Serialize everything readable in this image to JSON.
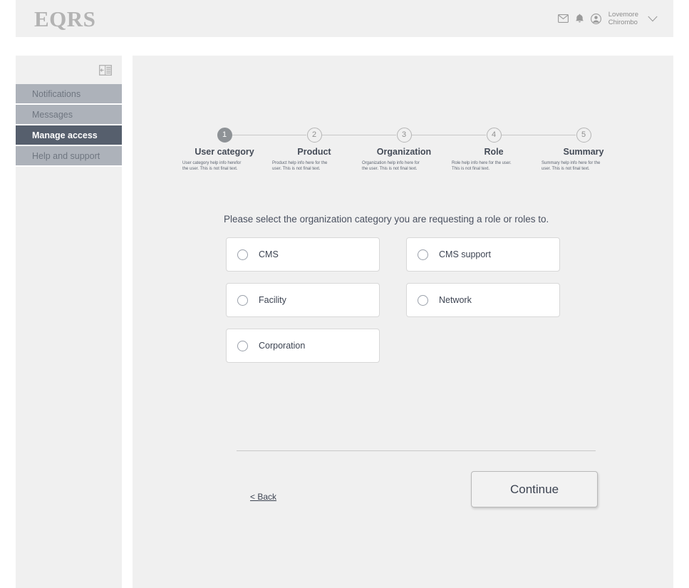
{
  "header": {
    "brand": "EQRS",
    "mail_icon": "envelope-icon",
    "bell_icon": "bell-icon",
    "avatar_icon": "avatar-icon",
    "user_first_name": "Lovemore",
    "user_last_name": "Chirombo",
    "chevron_icon": "chevron-down-icon"
  },
  "sidebar": {
    "collapse_icon": "collapse-sidebar-icon",
    "items": [
      {
        "label": "Notifications",
        "active": false
      },
      {
        "label": "Messages",
        "active": false
      },
      {
        "label": "Manage access",
        "active": true
      },
      {
        "label": "Help and support",
        "active": false
      }
    ]
  },
  "stepper": {
    "steps": [
      {
        "number": "1",
        "title": "User category",
        "help": "User category help info herefor the user. This is not final text.",
        "state": "done"
      },
      {
        "number": "2",
        "title": "Product",
        "help": "Product help info here for the user. This is not final text.",
        "state": "todo"
      },
      {
        "number": "3",
        "title": "Organization",
        "help": "Organization help info here for the user. This is not final text.",
        "state": "todo"
      },
      {
        "number": "4",
        "title": "Role",
        "help": "Role help info here for the user. This is not final text.",
        "state": "todo"
      },
      {
        "number": "5",
        "title": "Summary",
        "help": "Summary help info here for the user. This is not final text.",
        "state": "todo"
      }
    ]
  },
  "main": {
    "question": "Please select the organization category you are requesting a role or roles to.",
    "options": [
      {
        "label": "CMS",
        "selected": false
      },
      {
        "label": "CMS support",
        "selected": false
      },
      {
        "label": "Facility",
        "selected": false
      },
      {
        "label": "Network",
        "selected": false
      },
      {
        "label": "Corporation",
        "selected": false
      }
    ],
    "back_label": "< Back",
    "continue_label": "Continue"
  },
  "colors": {
    "page_bg": "#ffffff",
    "panel_bg": "#f0f0f0",
    "nav_item_bg": "#adb2ba",
    "nav_item_active_bg": "#565f6d",
    "step_done": "#8e9296",
    "text_dark": "#3d4452",
    "border": "#d8d8d8"
  }
}
